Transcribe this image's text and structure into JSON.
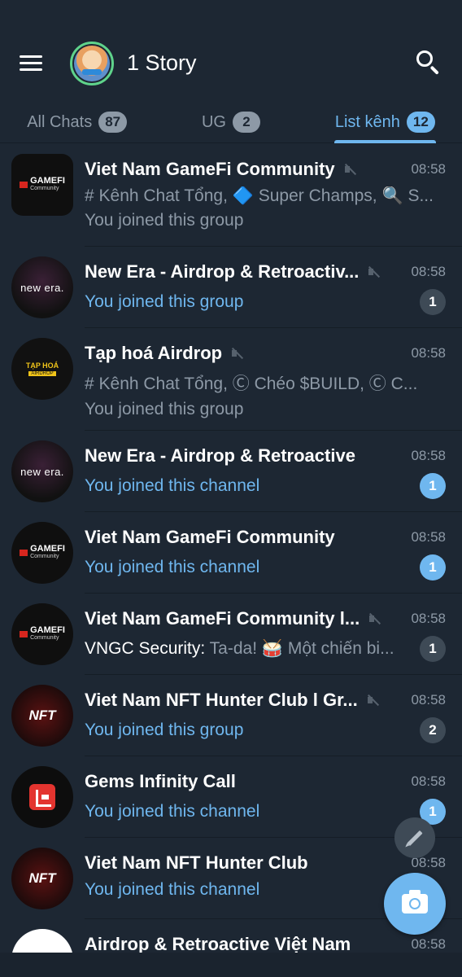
{
  "header": {
    "title": "1 Story",
    "menu_icon": "menu-icon",
    "search_icon": "search-icon"
  },
  "tabs": [
    {
      "label": "All Chats",
      "count": "87",
      "active": false
    },
    {
      "label": "UG",
      "count": "2",
      "active": false
    },
    {
      "label": "List kênh",
      "count": "12",
      "active": true
    }
  ],
  "chats": [
    {
      "name": "Viet Nam GameFi Community",
      "muted": true,
      "time": "08:58",
      "line1": "# Kênh Chat Tổng, 🔷 Super Champs, 🔍 S...",
      "line2": "You joined this group"
    },
    {
      "name": "New Era - Airdrop & Retroactiv...",
      "muted": true,
      "time": "08:58",
      "message": "You joined this group",
      "unread": "1"
    },
    {
      "name": "Tạp hoá Airdrop",
      "muted": true,
      "time": "08:58",
      "line1": "# Kênh Chat Tổng, Ⓒ Chéo $BUILD, Ⓒ C...",
      "line2": "You joined this group"
    },
    {
      "name": "New Era - Airdrop & Retroactive",
      "muted": false,
      "time": "08:58",
      "message": "You joined this channel",
      "unread": "1"
    },
    {
      "name": "Viet Nam GameFi Community",
      "muted": false,
      "time": "08:58",
      "message": "You joined this channel",
      "unread": "1"
    },
    {
      "name": "Viet Nam GameFi Community l...",
      "muted": true,
      "time": "08:58",
      "sender": "VNGC Security:",
      "message": " Ta-da! 🥁 Một chiến bi...",
      "unread": "1"
    },
    {
      "name": "Viet Nam NFT Hunter Club l Gr...",
      "muted": true,
      "time": "08:58",
      "message": "You joined this group",
      "unread": "2"
    },
    {
      "name": "Gems Infinity Call",
      "muted": false,
      "time": "08:58",
      "message": "You joined this channel",
      "unread": "1"
    },
    {
      "name": "Viet Nam NFT Hunter Club",
      "muted": false,
      "time": "08:58",
      "message": "You joined this channel"
    },
    {
      "name": "Airdrop & Retroactive Việt Nam",
      "muted": false,
      "time": "08:58"
    }
  ],
  "avatars": {
    "gamefi": {
      "brand": "GAMEFI",
      "sub": "Community"
    },
    "newera": {
      "brand": "new era."
    },
    "taphoa": {
      "brand": "TẠP HOÁ",
      "sub": "AIRDROP"
    },
    "nft": {
      "brand": "NFT"
    }
  },
  "fab": {
    "edit_icon": "pencil-icon",
    "camera_icon": "camera-icon"
  },
  "colors": {
    "background": "#1d2733",
    "accent": "#6fb7ef",
    "muted_badge": "#3e4a56"
  }
}
